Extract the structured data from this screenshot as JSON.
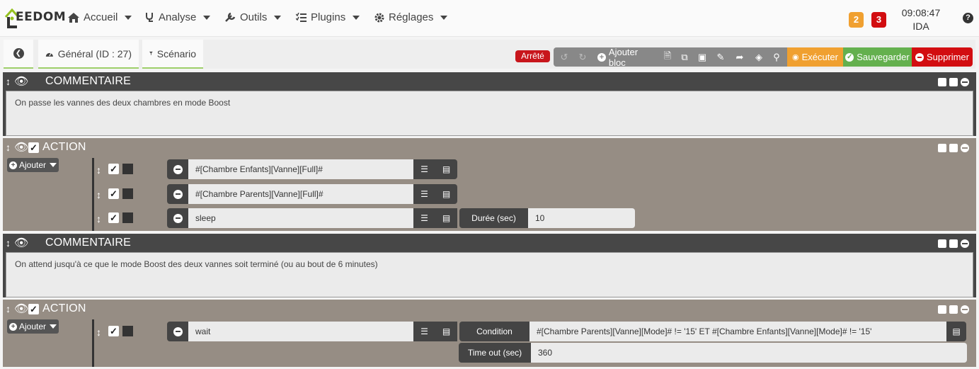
{
  "nav": {
    "logo_text": "EEDOM",
    "items": [
      "Accueil",
      "Analyse",
      "Outils",
      "Plugins",
      "Réglages"
    ],
    "badge_warning": "2",
    "badge_danger": "3",
    "time": "09:08:47",
    "user": "IDA",
    "help": "?"
  },
  "tabs": {
    "general": "Général (ID : 27)",
    "scenario": "Scénario"
  },
  "toolbar": {
    "status": "Arrêté",
    "add_block": "Ajouter bloc",
    "execute": "Exécuter",
    "save": "Sauvegarder",
    "delete": "Supprimer"
  },
  "blocks": [
    {
      "type": "COMMENTAIRE",
      "text": "On passe les vannes des deux chambres en mode Boost"
    },
    {
      "type": "ACTION",
      "add": "Ajouter",
      "rows": [
        {
          "cmd": "#[Chambre Enfants][Vanne][Full]#"
        },
        {
          "cmd": "#[Chambre Parents][Vanne][Full]#"
        },
        {
          "cmd": "sleep",
          "param_label": "Durée (sec)",
          "param_value": "10"
        }
      ]
    },
    {
      "type": "COMMENTAIRE",
      "text": "On attend jusqu'à ce que le mode Boost des deux vannes soit terminé (ou au bout de 6 minutes)"
    },
    {
      "type": "ACTION",
      "add": "Ajouter",
      "rows": [
        {
          "cmd": "wait",
          "condition_label": "Condition",
          "condition_value": "#[Chambre Parents][Vanne][Mode]# != '15' ET #[Chambre Enfants][Vanne][Mode]# != '15'",
          "timeout_label": "Time out (sec)",
          "timeout_value": "360"
        }
      ]
    }
  ],
  "colors": {
    "comment_bg": "#474747",
    "action_bg": "#968d84",
    "execute": "#f0a030",
    "save": "#64b04e",
    "delete": "#d20d10",
    "status": "#c8161c"
  }
}
